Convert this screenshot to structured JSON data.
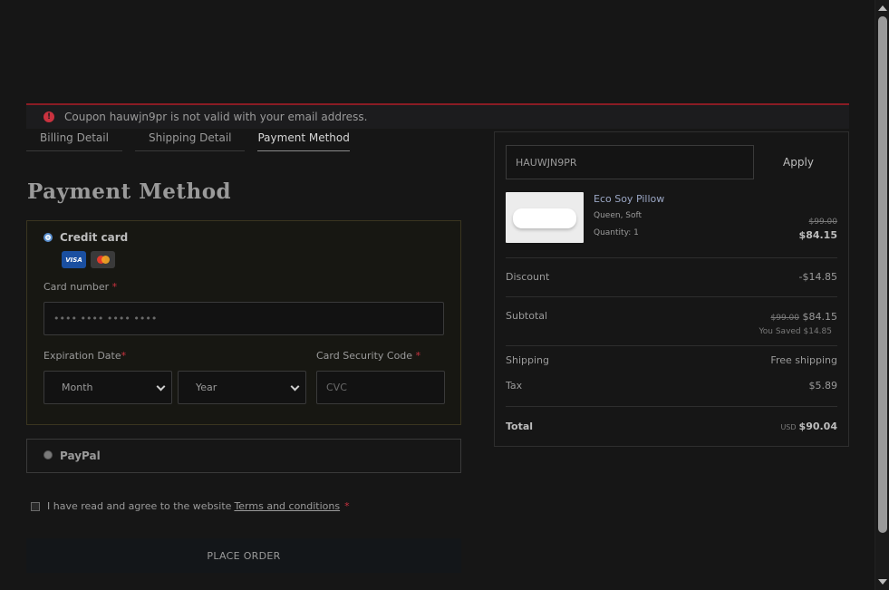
{
  "alert": {
    "message": "Coupon hauwjn9pr is not valid with your email address.",
    "icon": "error-icon"
  },
  "tabs": [
    {
      "label": "Billing Detail"
    },
    {
      "label": "Shipping Detail"
    },
    {
      "label": "Payment Method",
      "active": true
    }
  ],
  "page_title": "Payment Method",
  "payment": {
    "credit_card_label": "Credit card",
    "card_brands": [
      "VISA",
      "Mastercard"
    ],
    "card_number_label": "Card number",
    "card_number_placeholder": "•••• •••• •••• ••••",
    "expiration_label": "Expiration Date",
    "month_value": "Month",
    "year_value": "Year",
    "security_code_label": "Card Security Code",
    "cvc_placeholder": "CVC",
    "required_mark": "*",
    "paypal_label": "PayPal"
  },
  "terms": {
    "text": "I have read and agree to the website",
    "link": "Terms and conditions",
    "required_mark": "*"
  },
  "place_order_label": "PLACE ORDER",
  "summary": {
    "coupon_value": "HAUWJN9PR",
    "apply_label": "Apply",
    "product": {
      "name": "Eco Soy Pillow",
      "variant": "Queen, Soft",
      "quantity": "Quantity: 1",
      "old_price": "$99.00",
      "price": "$84.15"
    },
    "discount_label": "Discount",
    "discount_value": "-$14.85",
    "subtotal_label": "Subtotal",
    "subtotal_old": "$99.00",
    "subtotal_value": "$84.15",
    "you_saved": "You Saved $14.85",
    "shipping_label": "Shipping",
    "shipping_value": "Free shipping",
    "tax_label": "Tax",
    "tax_value": "$5.89",
    "total_label": "Total",
    "total_currency": "USD",
    "total_value": "$90.04"
  }
}
